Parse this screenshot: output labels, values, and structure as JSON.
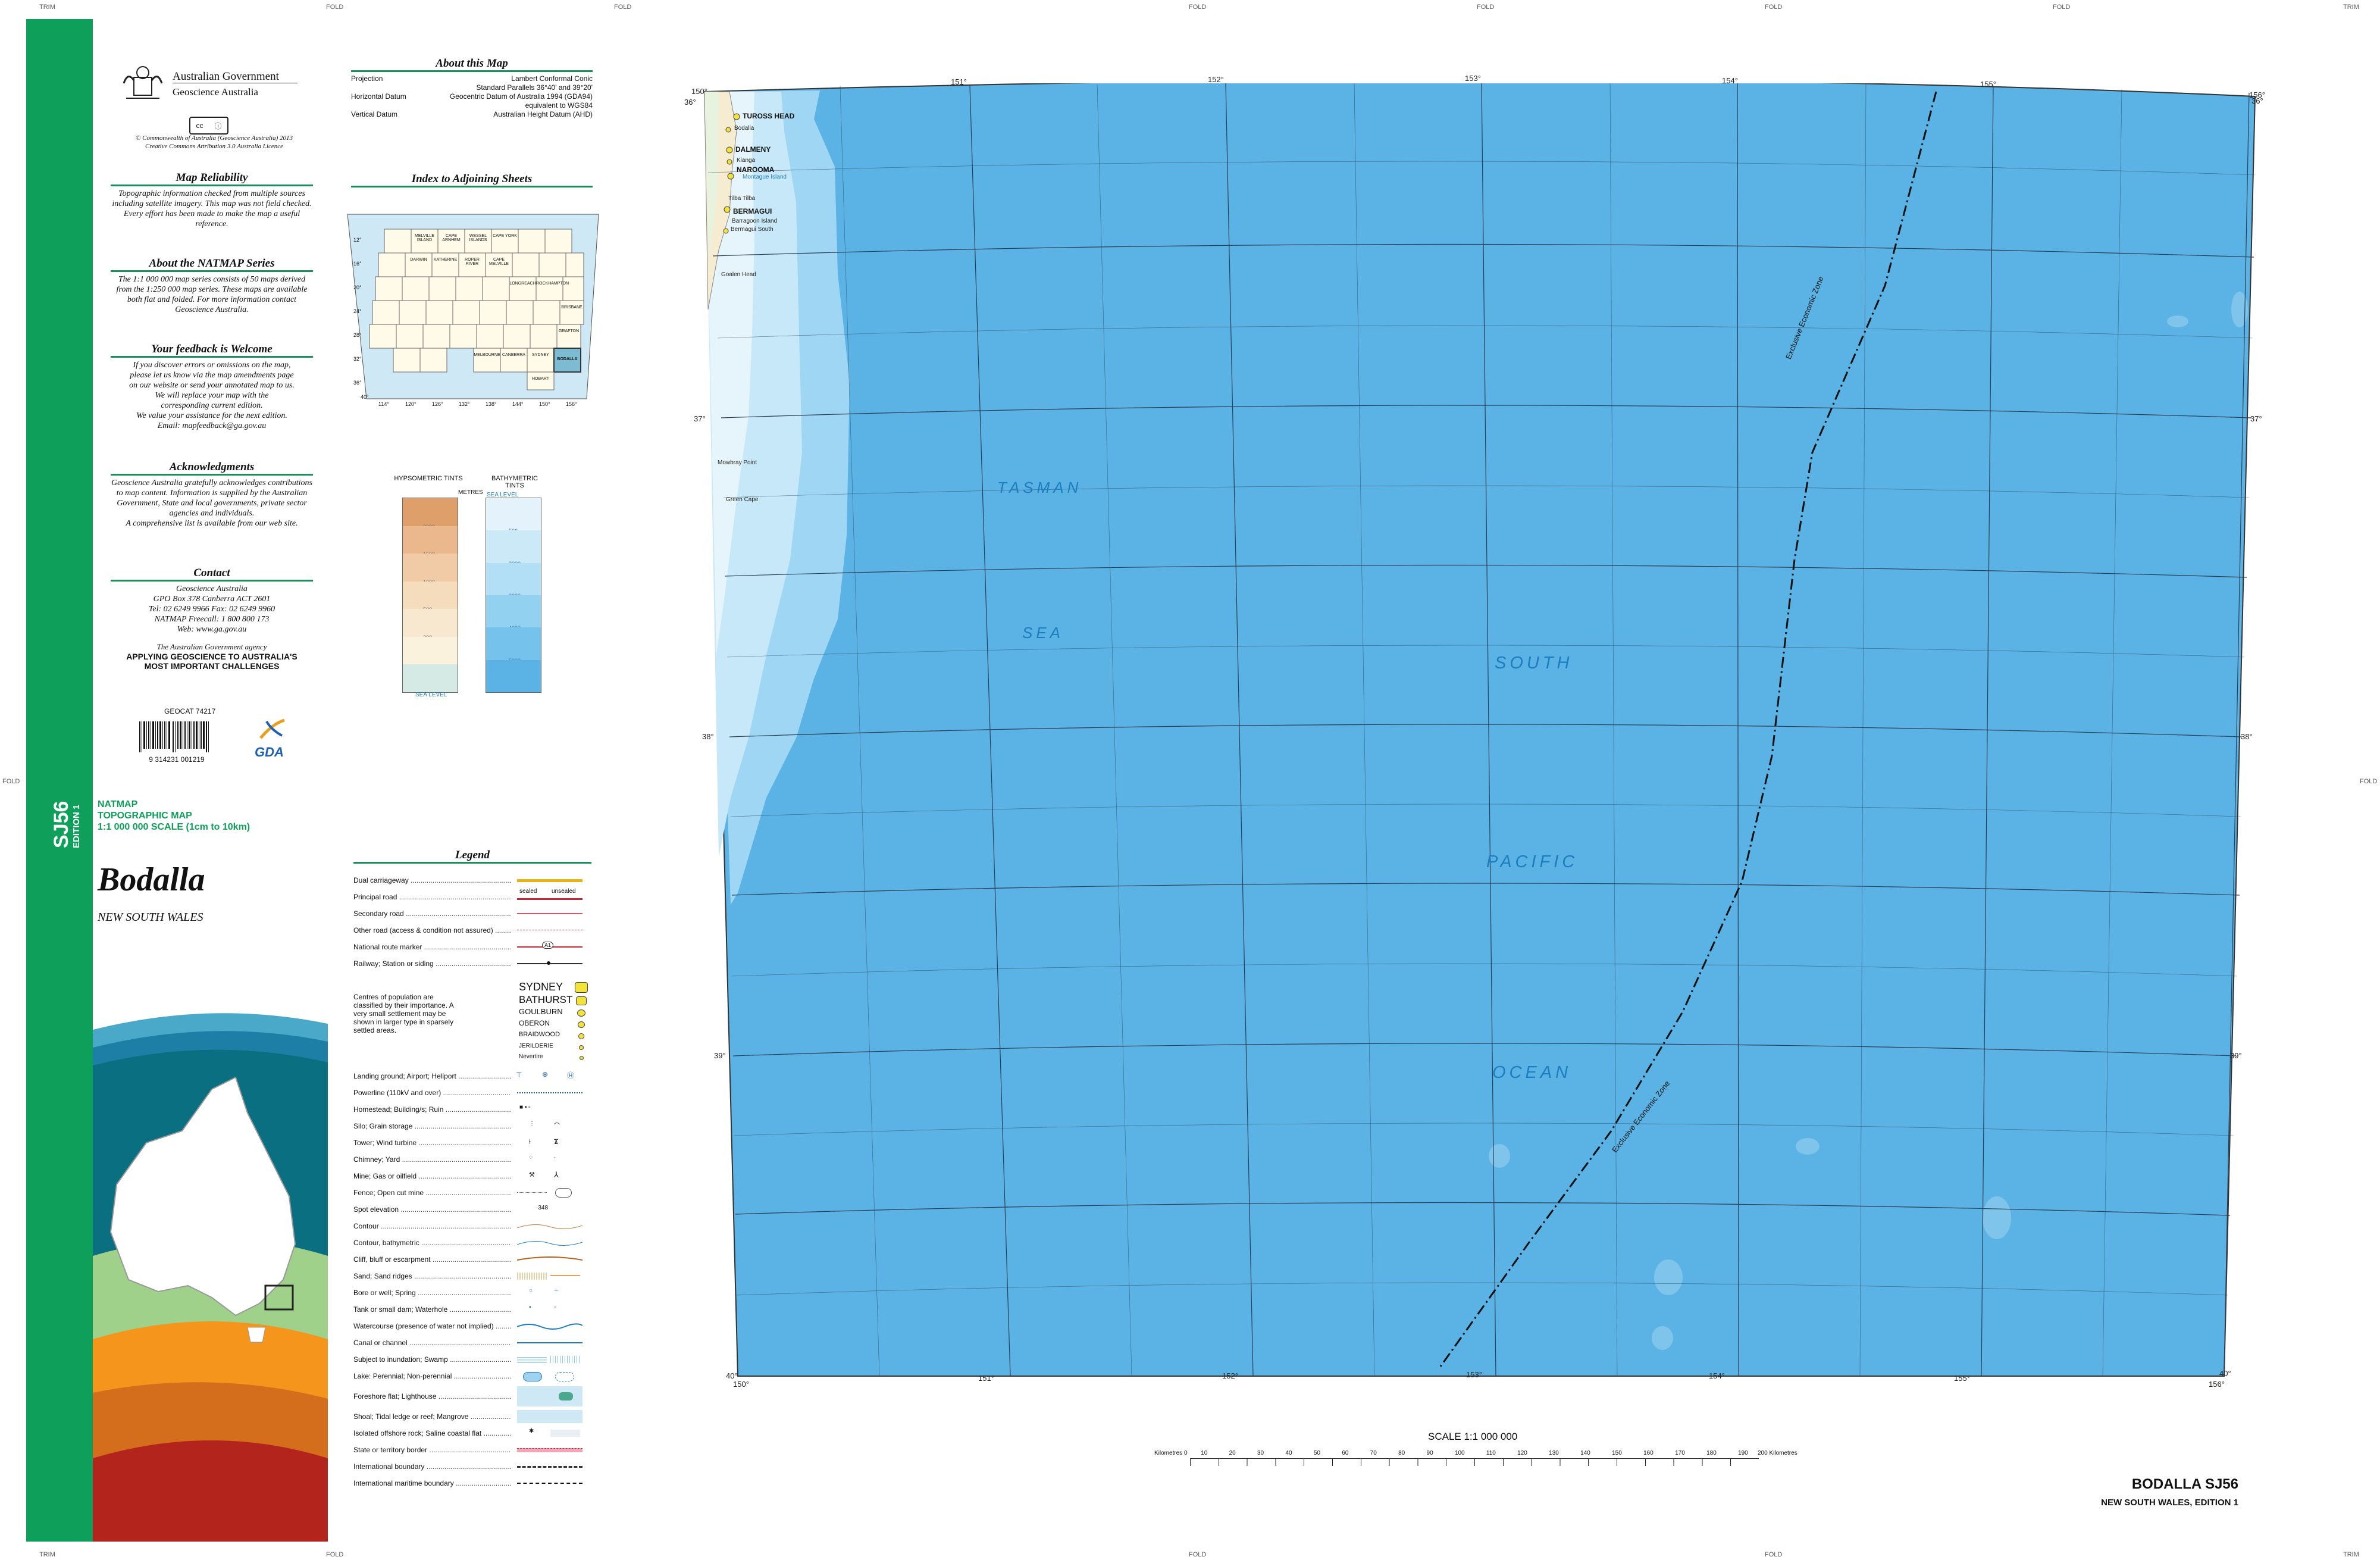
{
  "margins": {
    "trim": "TRIM",
    "fold": "FOLD"
  },
  "spine": {
    "code": "SJ56",
    "edition": "EDITION 1"
  },
  "govt": {
    "line1": "Australian Government",
    "line2": "Geoscience Australia",
    "copyright1": "© Commonwealth of Australia (Geoscience Australia) 2013",
    "copyright2": "Creative Commons Attribution 3.0 Australia Licence"
  },
  "reliability": {
    "title": "Map Reliability",
    "text": "Topographic information checked from multiple sources including satellite imagery. This map was not field checked. Every effort has been made to make the map a useful reference."
  },
  "natmap": {
    "title": "About the NATMAP Series",
    "text": "The 1:1 000 000 map series consists of 50 maps derived from the 1:250 000 map series. These maps are available both flat and folded. For more information contact Geoscience Australia."
  },
  "feedback": {
    "title": "Your feedback is Welcome",
    "lines": [
      "If you discover errors or omissions on the map,",
      "please let us know via the map amendments page",
      "on our website or send your annotated map to us.",
      "We will replace your map with the",
      "corresponding current edition.",
      "We value your assistance for the next edition.",
      "Email: mapfeedback@ga.gov.au"
    ]
  },
  "ack": {
    "title": "Acknowledgments",
    "text": "Geoscience Australia gratefully acknowledges contributions to map content. Information is supplied by the Australian Government, State and local governments, private sector agencies and individuals.",
    "text2": "A comprehensive list is available from our web site."
  },
  "contact": {
    "title": "Contact",
    "lines": [
      "Geoscience Australia",
      "GPO Box 378 Canberra ACT 2601",
      "Tel: 02 6249 9966 Fax: 02 6249 9960",
      "NATMAP Freecall: 1 800 800 173",
      "Web: www.ga.gov.au"
    ],
    "agency": "The Australian Government agency",
    "slogan1": "APPLYING GEOSCIENCE TO AUSTRALIA'S",
    "slogan2": "MOST IMPORTANT CHALLENGES"
  },
  "geodcat": "GEOCAT 74217",
  "barcode": {
    "digits": "9 314231 001219"
  },
  "gda": "GDA",
  "about_map": {
    "title": "About this Map",
    "rows": [
      {
        "label": "Projection",
        "value": "Lambert Conformal Conic"
      },
      {
        "label": "",
        "value": "Standard Parallels 36°40' and 39°20'"
      },
      {
        "label": "Horizontal Datum",
        "value": "Geocentric Datum of Australia 1994 (GDA94)"
      },
      {
        "label": "",
        "value": "equivalent to WGS84"
      },
      {
        "label": "Vertical Datum",
        "value": "Australian Height Datum (AHD)"
      }
    ]
  },
  "index": {
    "title": "Index to Adjoining Sheets",
    "sheets": [
      "MELVILLE ISLAND",
      "CAPE ARNHEM",
      "WESSEL ISLANDS",
      "CAPE YORK",
      "DARWIN",
      "KATHERINE",
      "ROPER RIVER",
      "CAPE MELVILLE",
      "LONGREACH",
      "ROCKHAMPTON",
      "BRISBANE",
      "GRAFTON",
      "SYDNEY",
      "BODALLA",
      "CANBERRA",
      "MELBOURNE",
      "HOBART"
    ],
    "lon_labels": [
      "114°",
      "120°",
      "126°",
      "132°",
      "138°",
      "144°",
      "150°",
      "156°"
    ],
    "lat_labels": [
      "12°",
      "16°",
      "20°",
      "24°",
      "28°",
      "32°",
      "36°",
      "40°"
    ]
  },
  "tints": {
    "hyp_title": "HYPSOMETRIC TINTS",
    "bath_title": "BATHYMETRIC TINTS",
    "metres": "METRES",
    "sea_level": "SEA LEVEL",
    "hyp_colors": [
      "#de9f6b",
      "#eab88c",
      "#f1cba6",
      "#f5dcbd",
      "#f8e8cf",
      "#fbf2dd",
      "#d5e9e5"
    ],
    "hyp_values": [
      "2000",
      "1500",
      "1000",
      "500",
      "200",
      ""
    ],
    "bath_colors": [
      "#e4f3fb",
      "#cce9f8",
      "#b2dff5",
      "#93d1f1",
      "#75c3ec",
      "#5ab3e4"
    ],
    "bath_values": [
      "500",
      "2000",
      "3000",
      "4000",
      "5000"
    ]
  },
  "title_block": {
    "series": "NATMAP",
    "type": "TOPOGRAPHIC MAP",
    "scale": "1:1 000 000 SCALE (1cm to 10km)",
    "name": "Bodalla",
    "state": "NEW SOUTH WALES"
  },
  "legend": {
    "title": "Legend",
    "items": [
      "Dual carriageway",
      "Principal road",
      "Secondary road",
      "Other road (access & condition not assured)",
      "National route marker",
      "Railway; Station or siding"
    ],
    "sealed": "sealed",
    "unsealed": "unsealed",
    "route": "A1",
    "population_text": "Centres of population are classified by their importance. A very small settlement may be shown in larger type in sparsely settled areas.",
    "population": [
      "SYDNEY",
      "BATHURST",
      "GOULBURN",
      "OBERON",
      "BRAIDWOOD",
      "JERILDERIE",
      "Nevertire"
    ],
    "items2": [
      "Landing ground; Airport; Heliport",
      "Powerline (110kV and over)",
      "Homestead; Building/s; Ruin",
      "Silo; Grain storage",
      "Tower; Wind turbine",
      "Chimney; Yard",
      "Mine; Gas or oilfield",
      "Fence; Open cut mine",
      "Spot elevation",
      "Contour",
      "Contour, bathymetric",
      "Cliff, bluff or escarpment",
      "Sand; Sand ridges",
      "Bore or well; Spring",
      "Tank or small dam; Waterhole",
      "Watercourse (presence of water not implied)",
      "Canal or channel",
      "Subject to inundation; Swamp",
      "Lake: Perennial; Non-perennial",
      "Foreshore flat; Lighthouse",
      "Shoal; Tidal ledge or reef; Mangrove",
      "Isolated offshore rock; Saline coastal flat",
      "State or territory border",
      "International boundary",
      "International maritime boundary"
    ],
    "spot": "·348"
  },
  "map": {
    "lon_top": [
      "150°",
      "151°",
      "152°",
      "153°",
      "154°",
      "155°",
      "156°"
    ],
    "lon_bottom": [
      "150°",
      "151°",
      "152°",
      "153°",
      "154°",
      "155°",
      "156°"
    ],
    "lat_labels": [
      "36°",
      "37°",
      "38°",
      "39°",
      "40°"
    ],
    "ocean_words": [
      "TASMAN",
      "SEA",
      "SOUTH",
      "PACIFIC",
      "OCEAN"
    ],
    "eez": "Exclusive Economic Zone",
    "towns": [
      "TUROSS HEAD",
      "Bodalla",
      "DALMENY",
      "Kianga",
      "NAROOMA",
      "Montague Island",
      "Tilba Tilba",
      "BERMAGUI",
      "Barragoon Island",
      "Bermagui South",
      "Goalen Head",
      "Mowbray Point",
      "Green Cape"
    ]
  },
  "scalebar": {
    "title": "SCALE 1:1 000 000",
    "left": "Kilometres 0",
    "right": "200 Kilometres",
    "ticks": [
      "10",
      "20",
      "30",
      "40",
      "50",
      "60",
      "70",
      "80",
      "90",
      "100",
      "110",
      "120",
      "130",
      "140",
      "150",
      "160",
      "170",
      "180",
      "190"
    ]
  },
  "sheet": {
    "name": "BODALLA SJ56",
    "sub": "NEW SOUTH WALES, EDITION 1"
  }
}
